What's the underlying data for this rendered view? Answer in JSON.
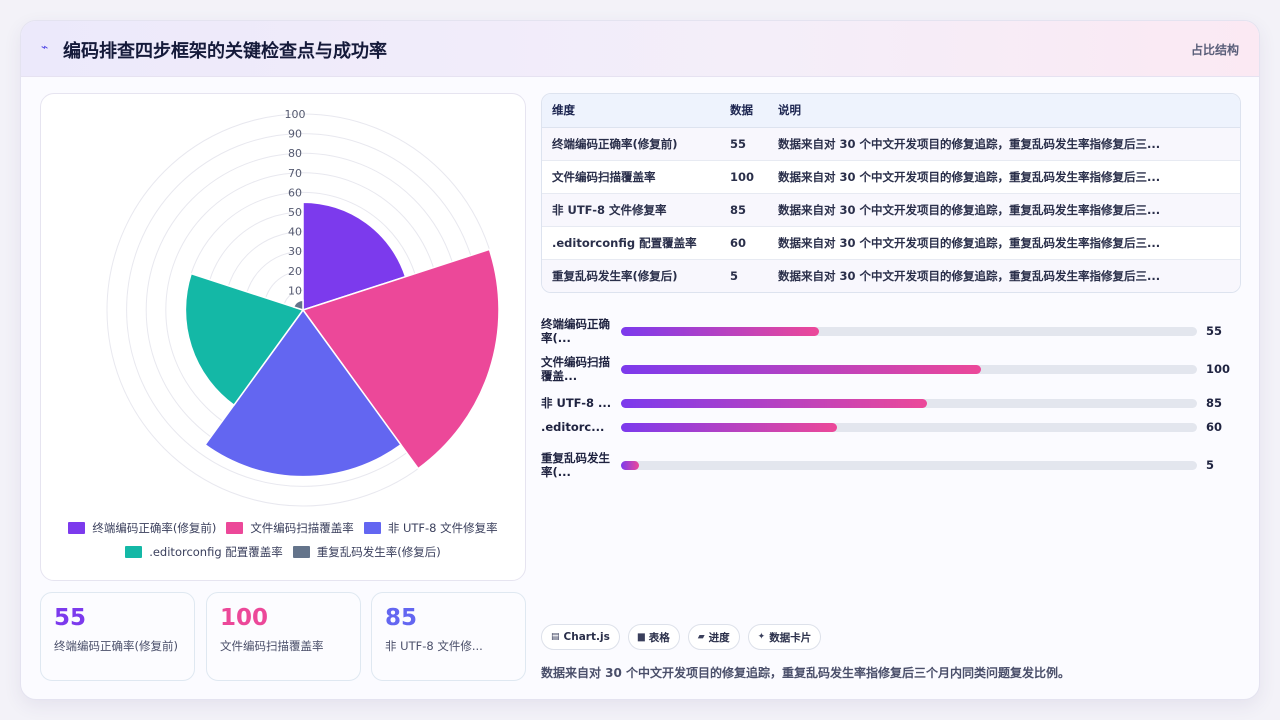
{
  "header": {
    "title": "编码排查四步框架的关键检查点与成功率",
    "title_icon": "sparkline-icon",
    "tag": "占比结构"
  },
  "chart_data": {
    "type": "polarArea",
    "categories": [
      "终端编码正确率(修复前)",
      "文件编码扫描覆盖率",
      "非 UTF-8 文件修复率",
      ".editorconfig 配置覆盖率",
      "重复乱码发生率(修复后)"
    ],
    "values": [
      55,
      100,
      85,
      60,
      5
    ],
    "colors": [
      "#7c3aed",
      "#ec4899",
      "#6366f1",
      "#14b8a6",
      "#64748b"
    ],
    "rlim": [
      0,
      100
    ],
    "ticks": [
      10,
      20,
      30,
      40,
      50,
      60,
      70,
      80,
      90,
      100
    ],
    "legend_position": "bottom",
    "grid": true
  },
  "stats": [
    {
      "value": "55",
      "label": "终端编码正确率(修复前)",
      "color": "#7c3aed"
    },
    {
      "value": "100",
      "label": "文件编码扫描覆盖率",
      "color": "#ec4899"
    },
    {
      "value": "85",
      "label": "非 UTF-8 文件修...",
      "color": "#6366f1"
    }
  ],
  "table": {
    "headers": [
      "维度",
      "数据",
      "说明"
    ],
    "rows": [
      [
        "终端编码正确率(修复前)",
        "55",
        "数据来自对 30 个中文开发项目的修复追踪，重复乱码发生率指修复后三..."
      ],
      [
        "文件编码扫描覆盖率",
        "100",
        "数据来自对 30 个中文开发项目的修复追踪，重复乱码发生率指修复后三..."
      ],
      [
        "非 UTF-8 文件修复率",
        "85",
        "数据来自对 30 个中文开发项目的修复追踪，重复乱码发生率指修复后三..."
      ],
      [
        ".editorconfig 配置覆盖率",
        "60",
        "数据来自对 30 个中文开发项目的修复追踪，重复乱码发生率指修复后三..."
      ],
      [
        "重复乱码发生率(修复后)",
        "5",
        "数据来自对 30 个中文开发项目的修复追踪，重复乱码发生率指修复后三..."
      ]
    ]
  },
  "progress": [
    {
      "label": "终端编码正确率(...",
      "value": 55,
      "display": "55"
    },
    {
      "label": "文件编码扫描覆盖...",
      "value": 100,
      "display": "100"
    },
    {
      "label": "非 UTF-8 ...",
      "value": 85,
      "display": "85"
    },
    {
      "label": ".editorc...",
      "value": 60,
      "display": "60"
    },
    {
      "label": "重复乱码发生率(...",
      "value": 5,
      "display": "5"
    }
  ],
  "progress_max": 160,
  "chips": [
    {
      "icon": "chart-icon",
      "glyph": "▤",
      "label": "Chart.js"
    },
    {
      "icon": "table-icon",
      "glyph": "▆",
      "label": "表格"
    },
    {
      "icon": "progress-icon",
      "glyph": "▰",
      "label": "进度"
    },
    {
      "icon": "sparkle-icon",
      "glyph": "✦",
      "label": "数据卡片"
    }
  ],
  "footnote": "数据来自对 30 个中文开发项目的修复追踪，重复乱码发生率指修复后三个月内同类问题复发比例。"
}
